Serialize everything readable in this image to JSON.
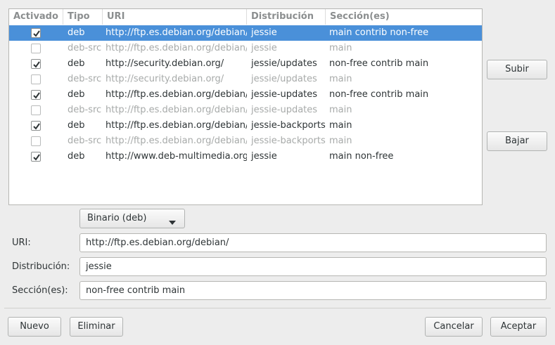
{
  "columns": [
    "Activado",
    "Tipo",
    "URI",
    "Distribución",
    "Sección(es)"
  ],
  "rows": [
    {
      "enabled": true,
      "type": "deb",
      "uri": "http://ftp.es.debian.org/debian/",
      "dist": "jessie",
      "sections": "main contrib non-free"
    },
    {
      "enabled": false,
      "type": "deb-src",
      "uri": "http://ftp.es.debian.org/debian/",
      "dist": "jessie",
      "sections": "main"
    },
    {
      "enabled": true,
      "type": "deb",
      "uri": "http://security.debian.org/",
      "dist": "jessie/updates",
      "sections": "non-free contrib main"
    },
    {
      "enabled": false,
      "type": "deb-src",
      "uri": "http://security.debian.org/",
      "dist": "jessie/updates",
      "sections": "main"
    },
    {
      "enabled": true,
      "type": "deb",
      "uri": "http://ftp.es.debian.org/debian/",
      "dist": "jessie-updates",
      "sections": "non-free contrib main"
    },
    {
      "enabled": false,
      "type": "deb-src",
      "uri": "http://ftp.es.debian.org/debian/",
      "dist": "jessie-updates",
      "sections": "main"
    },
    {
      "enabled": true,
      "type": "deb",
      "uri": "http://ftp.es.debian.org/debian/",
      "dist": "jessie-backports",
      "sections": "main"
    },
    {
      "enabled": false,
      "type": "deb-src",
      "uri": "http://ftp.es.debian.org/debian/",
      "dist": "jessie-backports",
      "sections": "main"
    },
    {
      "enabled": true,
      "type": "deb",
      "uri": "http://www.deb-multimedia.org/",
      "dist": "jessie",
      "sections": "main non-free"
    }
  ],
  "selected_row": 0,
  "side_buttons": {
    "up": "Subir",
    "down": "Bajar"
  },
  "type_combo": {
    "value": "Binario (deb)",
    "icon": "chevron-down-icon"
  },
  "form": {
    "uri_label": "URI:",
    "uri_value": "http://ftp.es.debian.org/debian/",
    "dist_label": "Distribución:",
    "dist_value": "jessie",
    "sections_label": "Sección(es):",
    "sections_value": "non-free contrib main"
  },
  "bottom_buttons": {
    "new": "Nuevo",
    "delete": "Eliminar",
    "cancel": "Cancelar",
    "accept": "Aceptar"
  },
  "colors": {
    "selection": "#4a90d9",
    "disabled_text": "#a7aaa9"
  }
}
